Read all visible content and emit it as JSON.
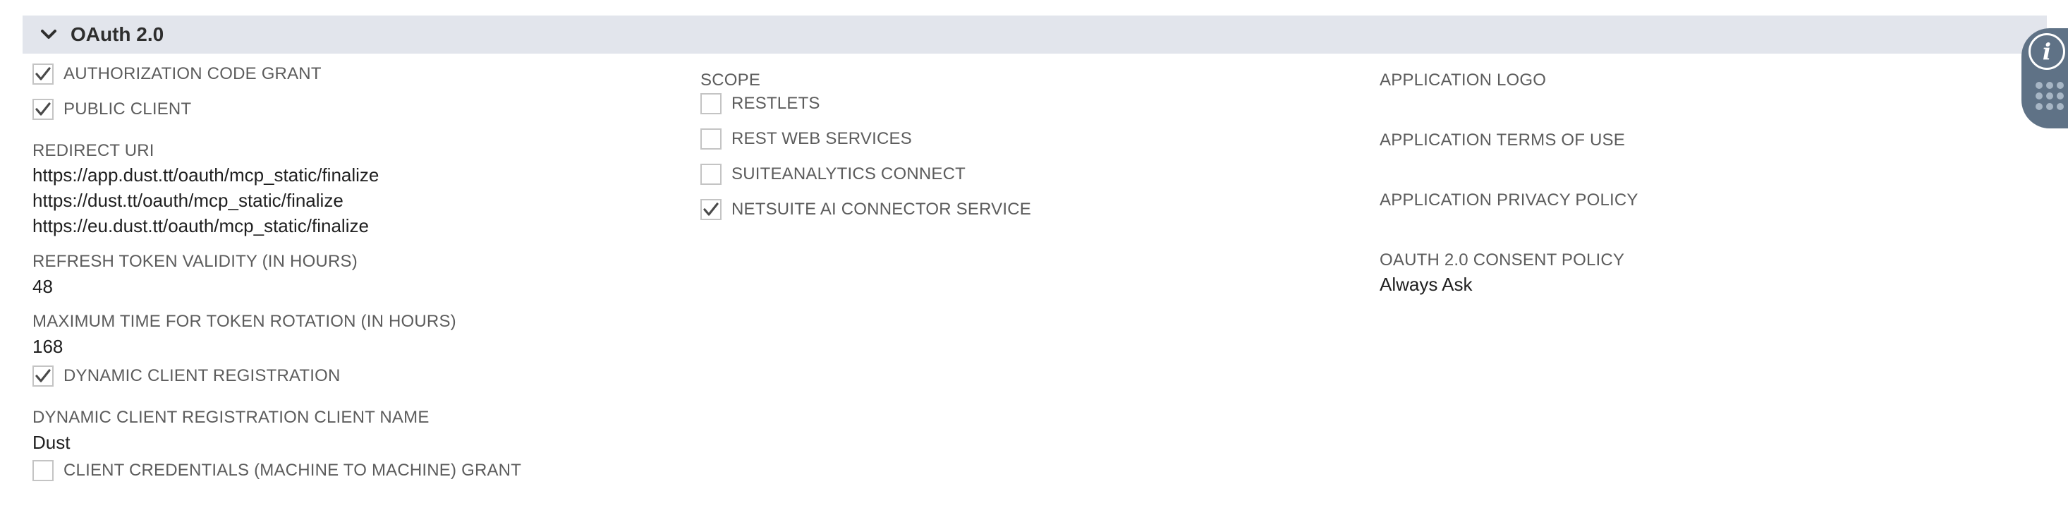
{
  "section": {
    "title": "OAuth 2.0"
  },
  "column1": {
    "authorization_code_grant": {
      "label": "AUTHORIZATION CODE GRANT",
      "checked": true
    },
    "public_client": {
      "label": "PUBLIC CLIENT",
      "checked": true
    },
    "redirect_uri": {
      "label": "REDIRECT URI",
      "values": [
        "https://app.dust.tt/oauth/mcp_static/finalize",
        "https://dust.tt/oauth/mcp_static/finalize",
        "https://eu.dust.tt/oauth/mcp_static/finalize"
      ]
    },
    "refresh_token_validity": {
      "label": "REFRESH TOKEN VALIDITY (IN HOURS)",
      "value": "48"
    },
    "max_token_rotation": {
      "label": "MAXIMUM TIME FOR TOKEN ROTATION (IN HOURS)",
      "value": "168"
    },
    "dynamic_client_registration": {
      "label": "DYNAMIC CLIENT REGISTRATION",
      "checked": true
    },
    "dcr_client_name": {
      "label": "DYNAMIC CLIENT REGISTRATION CLIENT NAME",
      "value": "Dust"
    },
    "client_credentials_grant": {
      "label": "CLIENT CREDENTIALS (MACHINE TO MACHINE) GRANT",
      "checked": false
    }
  },
  "column2": {
    "scope_label": "SCOPE",
    "scopes": [
      {
        "label": "RESTLETS",
        "checked": false
      },
      {
        "label": "REST WEB SERVICES",
        "checked": false
      },
      {
        "label": "SUITEANALYTICS CONNECT",
        "checked": false
      },
      {
        "label": "NETSUITE AI CONNECTOR SERVICE",
        "checked": true
      }
    ]
  },
  "column3": {
    "application_logo": {
      "label": "APPLICATION LOGO"
    },
    "terms_of_use": {
      "label": "APPLICATION TERMS OF USE"
    },
    "privacy_policy": {
      "label": "APPLICATION PRIVACY POLICY"
    },
    "consent_policy": {
      "label": "OAUTH 2.0 CONSENT POLICY",
      "value": "Always Ask"
    }
  },
  "side_widget": {
    "info_icon": "info-icon",
    "grid_icon": "grid-dots-icon",
    "color": "#5f7286"
  }
}
